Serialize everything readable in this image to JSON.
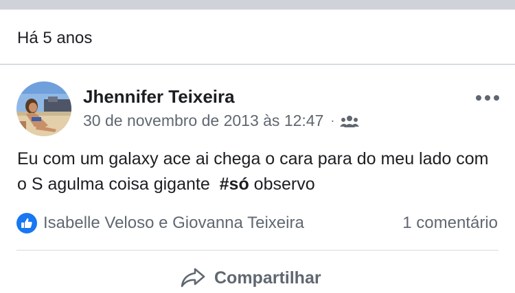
{
  "memory": {
    "title": "Há 5 anos"
  },
  "post": {
    "author": "Jhennifer Teixeira",
    "timestamp": "30 de novembro de 2013 às 12:47",
    "separator": "·",
    "audience_icon": "friends-icon",
    "more_icon": "more-horizontal-icon",
    "text_before": "Eu com um galaxy ace ai chega o cara para do meu lado com o S agulma coisa gigante  ",
    "hashtag": "#só",
    "text_after": " observo"
  },
  "reactions": {
    "icon": "like-icon",
    "names": "Isabelle Veloso e Giovanna Teixeira",
    "comments": "1 comentário"
  },
  "actions": {
    "share_icon": "share-arrow-icon",
    "share_label": "Compartilhar"
  },
  "colors": {
    "like_blue": "#1877f2",
    "secondary_text": "#606770",
    "primary_text": "#1c1e21",
    "divider": "#d8dbe0"
  }
}
